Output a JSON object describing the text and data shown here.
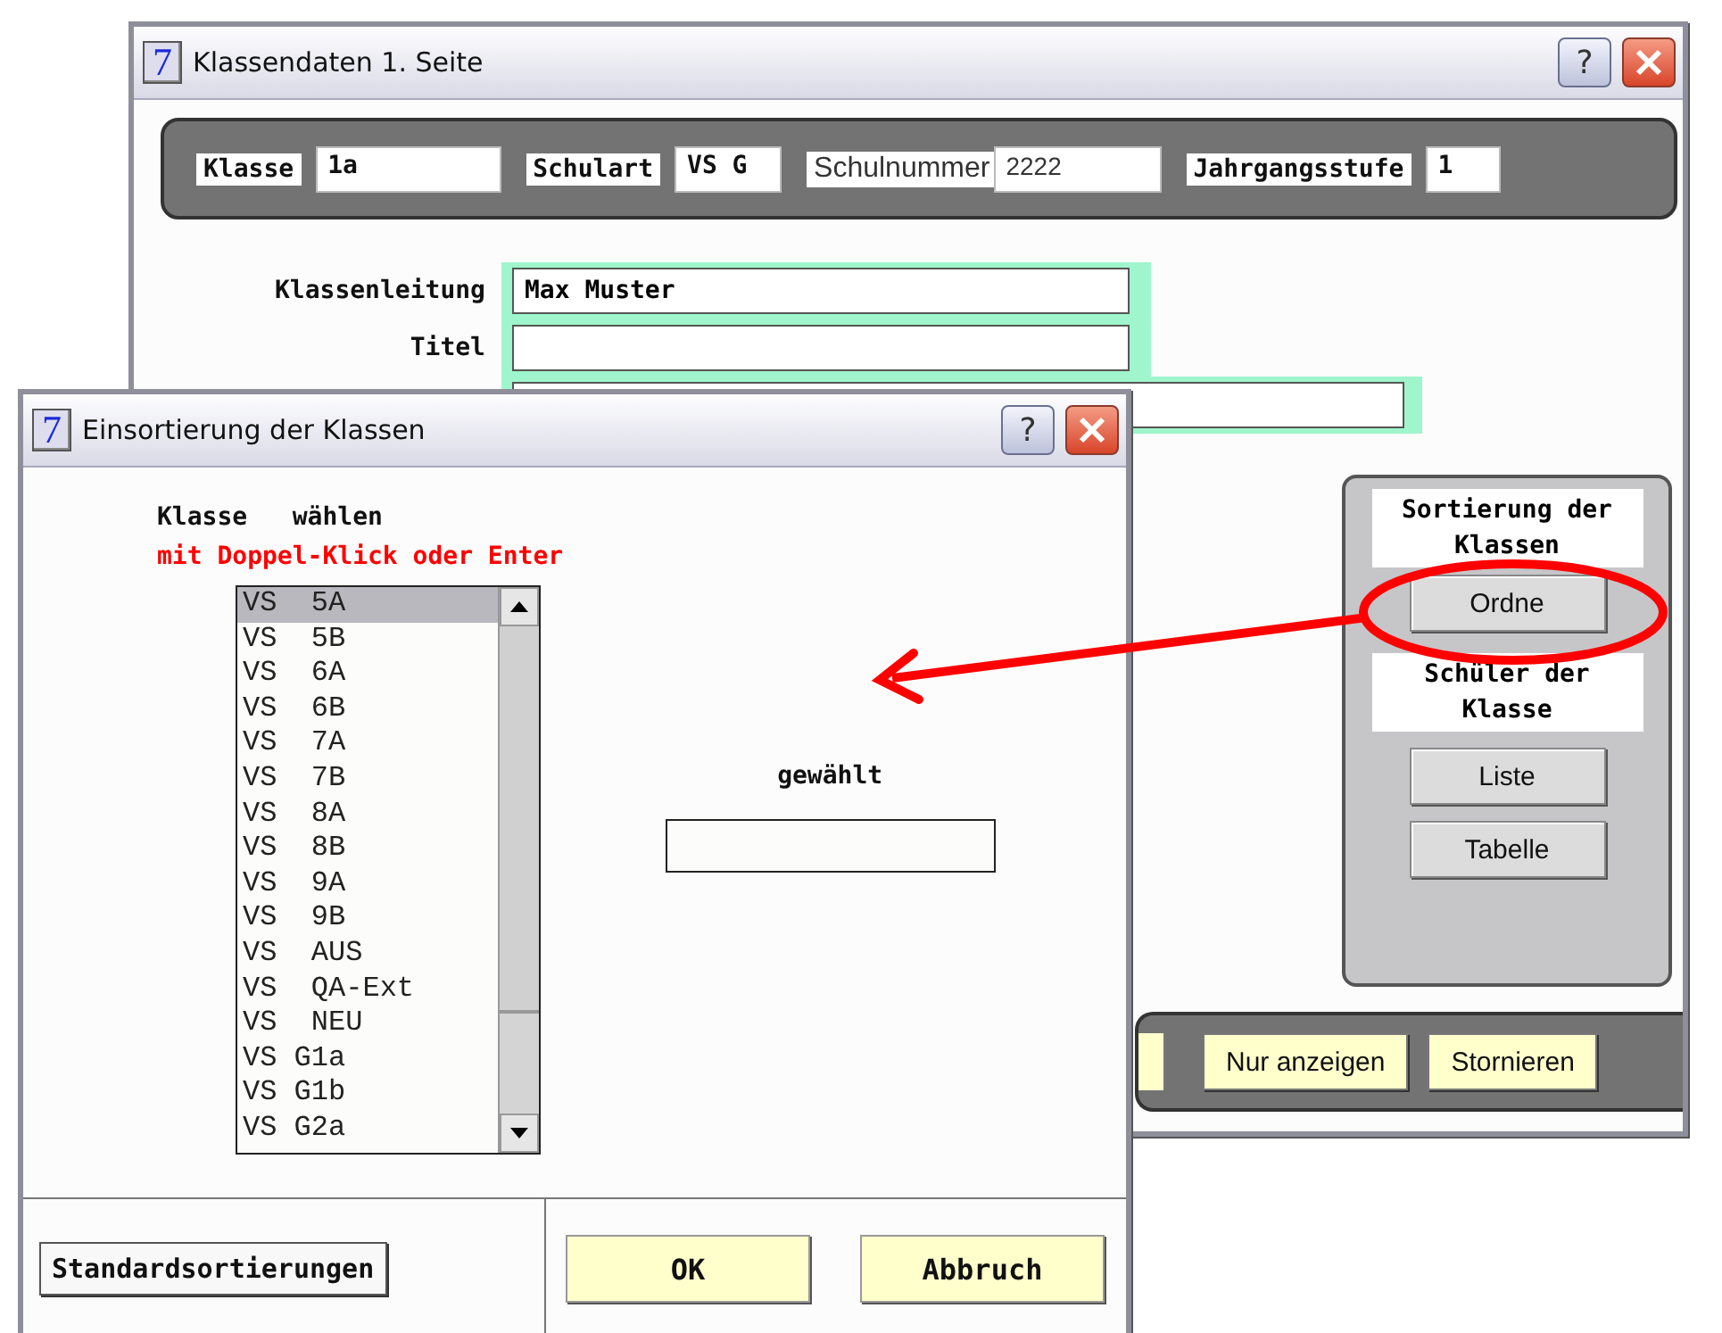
{
  "main_window": {
    "icon": "7",
    "title": "Klassendaten 1. Seite",
    "help": "?",
    "header_fields": [
      {
        "label": "Klasse",
        "value": "1a",
        "kind": "bold"
      },
      {
        "label": "Schulart",
        "value": "VS G",
        "kind": "bold"
      },
      {
        "label": "Schulnummer",
        "value": "2222",
        "kind": "plain"
      },
      {
        "label": "Jahrgangsstufe",
        "value": "1",
        "kind": "bold"
      }
    ],
    "form": [
      {
        "kind": "normal",
        "label": "Klassenleitung",
        "value": "Max Muster"
      },
      {
        "kind": "normal",
        "label": "Titel"
      },
      {
        "kind": "wide"
      }
    ],
    "side_panel": {
      "sort_heading": "Sortierung der Klassen",
      "sort_button": "Ordne",
      "students_heading": "Schüler der Klasse",
      "students_buttons": [
        "Liste",
        "Tabelle"
      ]
    },
    "bottom_buttons": [
      "Nur anzeigen",
      "Stornieren"
    ]
  },
  "dialog": {
    "icon": "7",
    "title": "Einsortierung der Klassen",
    "help": "?",
    "instruction": "Klasse   wählen",
    "hint": "mit Doppel-Klick oder Enter",
    "classes": [
      {
        "text": "VS  5A",
        "selected": true
      },
      {
        "text": "VS  5B",
        "selected": false
      },
      {
        "text": "VS  6A",
        "selected": false
      },
      {
        "text": "VS  6B",
        "selected": false
      },
      {
        "text": "VS  7A",
        "selected": false
      },
      {
        "text": "VS  7B",
        "selected": false
      },
      {
        "text": "VS  8A",
        "selected": false
      },
      {
        "text": "VS  8B",
        "selected": false
      },
      {
        "text": "VS  9A",
        "selected": false
      },
      {
        "text": "VS  9B",
        "selected": false
      },
      {
        "text": "VS  AUS",
        "selected": false
      },
      {
        "text": "VS  QA-Ext",
        "selected": false
      },
      {
        "text": "VS  NEU",
        "selected": false
      },
      {
        "text": "VS G1a",
        "selected": false
      },
      {
        "text": "VS G1b",
        "selected": false
      },
      {
        "text": "VS G2a",
        "selected": false
      }
    ],
    "chosen_label": "gewählt",
    "buttons": [
      {
        "label": "Standardsortierungen",
        "kind": "plain"
      },
      {
        "label": "OK",
        "kind": "primary"
      },
      {
        "label": "Abbruch",
        "kind": "primary"
      }
    ]
  }
}
